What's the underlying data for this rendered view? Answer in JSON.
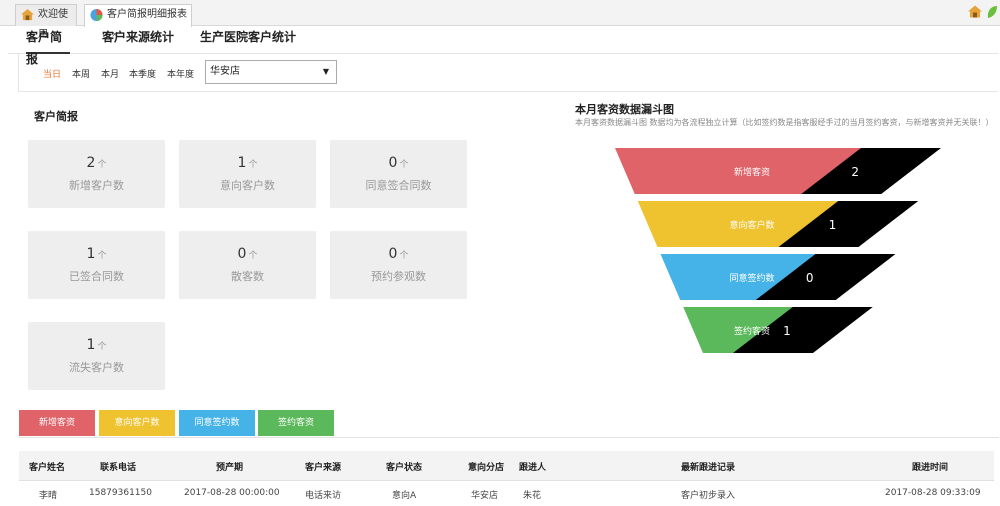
{
  "window_tabs": [
    {
      "label": "欢迎使用"
    },
    {
      "label": "客户简报明细报表",
      "close": "×"
    }
  ],
  "subnav": [
    "客户简报",
    "客户来源统计",
    "生产医院客户统计"
  ],
  "filters": {
    "periods": [
      "当日",
      "本周",
      "本月",
      "本季度",
      "本年度"
    ],
    "active_period": "当日",
    "store": "华安店"
  },
  "summary": {
    "title": "客户简报",
    "cards": [
      {
        "value": "2",
        "unit": "个",
        "label": "新增客户数"
      },
      {
        "value": "1",
        "unit": "个",
        "label": "意向客户数"
      },
      {
        "value": "0",
        "unit": "个",
        "label": "同意签合同数"
      },
      {
        "value": "1",
        "unit": "个",
        "label": "已签合同数"
      },
      {
        "value": "0",
        "unit": "个",
        "label": "散客数"
      },
      {
        "value": "0",
        "unit": "个",
        "label": "预约参观数"
      },
      {
        "value": "1",
        "unit": "个",
        "label": "流失客户数"
      }
    ]
  },
  "funnel": {
    "title": "本月客资数据漏斗图",
    "description": "本月客资数据漏斗图 数据均为各流程独立计算（比如签约数是指客服经手过的当月签约客资，与新增客资并无关联！）",
    "colors": [
      "#e0636a",
      "#efc22f",
      "#45b3e8",
      "#5bb85b"
    ]
  },
  "chart_data": {
    "type": "funnel",
    "title": "本月客资数据漏斗图",
    "categories": [
      "新增客资",
      "意向客户数",
      "同意签约数",
      "签约客资"
    ],
    "values": [
      2,
      1,
      0,
      1
    ]
  },
  "legend_buttons": [
    {
      "label": "新增客资",
      "color": "#e0636a"
    },
    {
      "label": "意向客户数",
      "color": "#efc22f"
    },
    {
      "label": "同意签约数",
      "color": "#45b3e8"
    },
    {
      "label": "签约客资",
      "color": "#5bb85b"
    }
  ],
  "table": {
    "headers": [
      "客户姓名",
      "联系电话",
      "预产期",
      "客户来源",
      "客户状态",
      "意向分店",
      "跟进人",
      "最新跟进记录",
      "跟进时间"
    ],
    "rows": [
      [
        "李晴",
        "15879361150",
        "2017-08-28 00:00:00",
        "电话来访",
        "意向A",
        "华安店",
        "朱花",
        "客户初步录入",
        "2017-08-28 09:33:09"
      ]
    ]
  }
}
